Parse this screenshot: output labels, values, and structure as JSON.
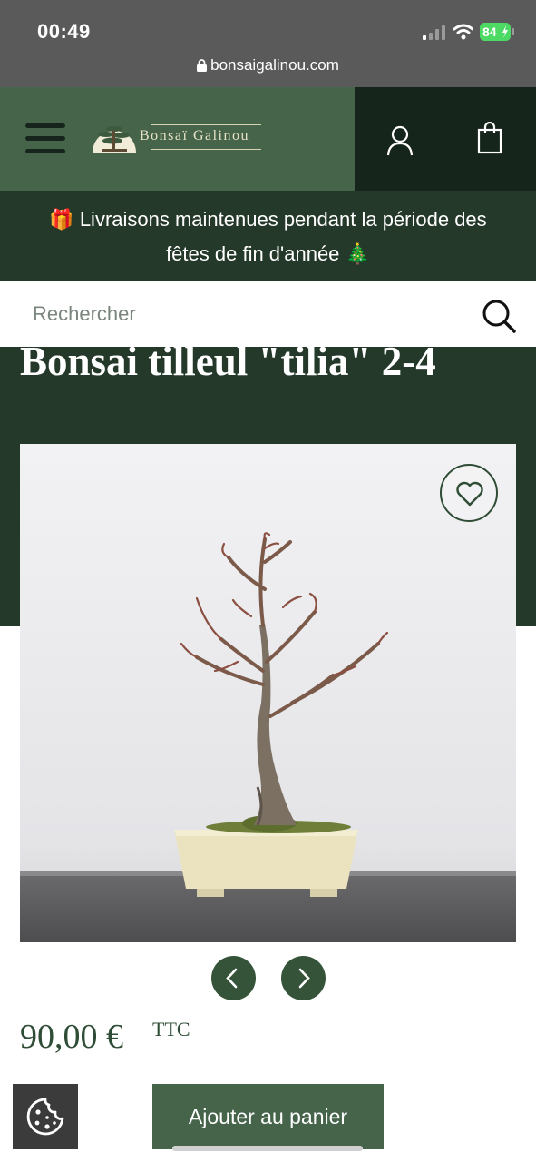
{
  "status_bar": {
    "time": "00:49",
    "battery": "84",
    "url": "bonsaigalinou.com"
  },
  "header": {
    "logo_text": "Bonsaï Galinou",
    "icons": [
      "menu-icon",
      "user-icon",
      "shopping-bag-icon"
    ]
  },
  "banner": {
    "line1": "🎁 Livraisons maintenues pendant la période des",
    "line2": "fêtes de fin d'année 🎄"
  },
  "search": {
    "placeholder": "Rechercher"
  },
  "product": {
    "title": "Bonsai tilleul \"tilia\" 2-4",
    "price": "90,00 €",
    "price_suffix": "TTC",
    "add_to_cart_label": "Ajouter au panier"
  },
  "colors": {
    "header_green": "#45644a",
    "dark_green": "#24392a",
    "darkest_green": "#15251b",
    "accent": "#2f4d36"
  }
}
